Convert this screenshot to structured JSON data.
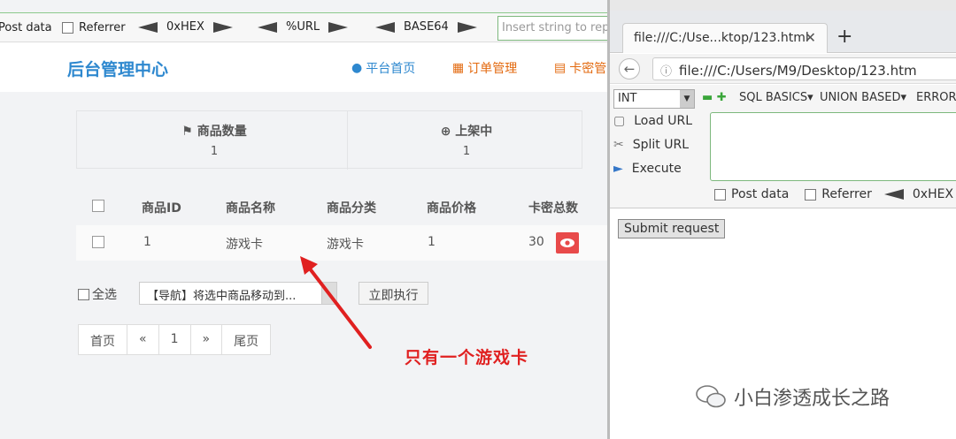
{
  "hackbar": {
    "post_data": "Post data",
    "referrer": "Referrer",
    "hex": "0xHEX",
    "url": "%URL",
    "base64": "BASE64",
    "input_placeholder": "Insert string to repl"
  },
  "admin": {
    "brand": "后台管理中心",
    "nav": [
      "平台首页",
      "订单管理",
      "卡密管"
    ],
    "stats": [
      {
        "label": "商品数量",
        "value": "1"
      },
      {
        "label": "上架中",
        "value": "1"
      }
    ],
    "columns": [
      "商品ID",
      "商品名称",
      "商品分类",
      "商品价格",
      "卡密总数"
    ],
    "row": {
      "id": "1",
      "name": "游戏卡",
      "category": "游戏卡",
      "price": "1",
      "total": "30"
    },
    "select_all": "全选",
    "bulk_option": "【导航】将选中商品移动到...",
    "run": "立即执行",
    "pager": [
      "首页",
      "«",
      "1",
      "»",
      "尾页"
    ]
  },
  "annotation": "只有一个游戏卡",
  "browser": {
    "tab_title": "file:///C:/Use...ktop/123.html",
    "url": "file:///C:/Users/M9/Desktop/123.htm",
    "hackbar": {
      "type": "INT",
      "menus": [
        "SQL BASICS▾",
        "UNION BASED▾",
        "ERROR/"
      ],
      "load_url": "Load URL",
      "split_url": "Split URL",
      "execute": "Execute",
      "post_data": "Post data",
      "referrer": "Referrer",
      "hex": "0xHEX"
    },
    "submit": "Submit request"
  },
  "watermark": "小白渗透成长之路"
}
